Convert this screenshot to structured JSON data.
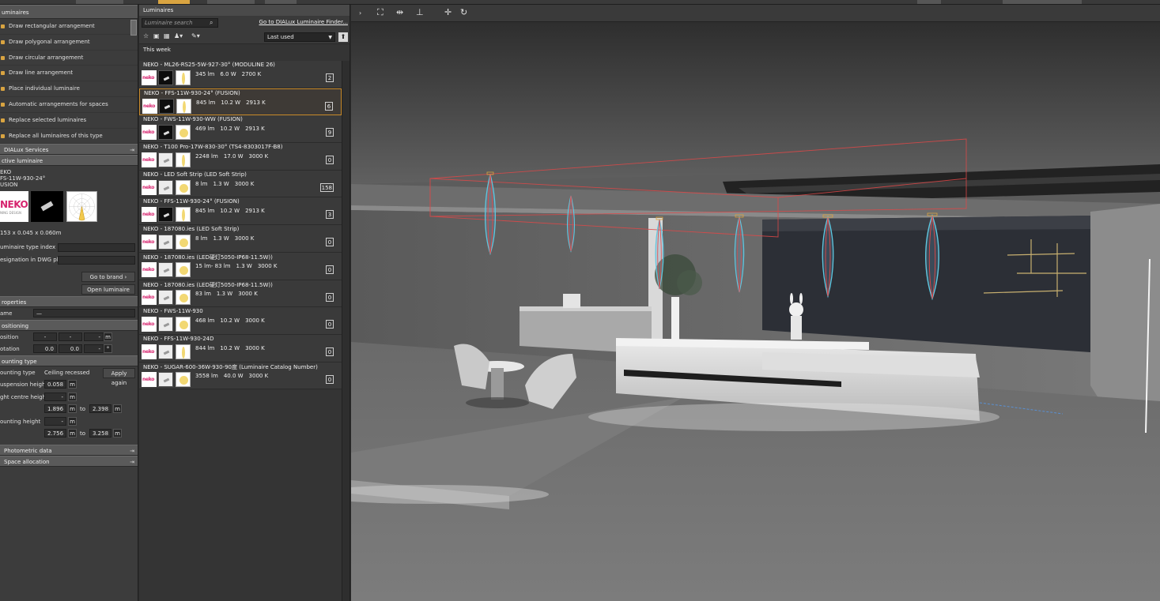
{
  "left_panel": {
    "luminaires_header": "uminaires",
    "actions": [
      "Draw rectangular arrangement",
      "Draw polygonal arrangement",
      "Draw circular arrangement",
      "Draw line arrangement",
      "Place individual luminaire",
      "Automatic arrangements for spaces",
      "Replace selected luminaires",
      "Replace all luminaires of this type"
    ],
    "services_header": "DIALux Services",
    "active_header": "ctive luminaire",
    "active": {
      "brand": "EKO",
      "model": "FS-11W-930-24°",
      "family": "USION",
      "logo_text": "NEKO",
      "logo_sub": "NING DESIGN",
      "dimensions": "153 x 0.045 x 0.060m",
      "type_index_label": "uminaire type index",
      "dwg_label": "esignation in DWG plan",
      "go_to_brand": "Go to brand",
      "open_list": "Open luminaire list"
    },
    "properties_header": "roperties",
    "name_label": "ame",
    "name_value": "—",
    "positioning_header": "ositioning",
    "position_label": "osition",
    "position_values": [
      "-",
      "-",
      "-"
    ],
    "rotation_label": "otation",
    "rotation_values": [
      "0.0",
      "0.0",
      "-"
    ],
    "unit_m": "m",
    "mounting_header": "ounting type",
    "mounting_type_label": "ounting type",
    "mounting_type_value": "Ceiling recessed",
    "apply_again": "Apply again",
    "suspension_label": "uspension height",
    "suspension_value": "0.058",
    "centre_label": "ght centre height",
    "centre_value": "-",
    "centre_from": "1.896",
    "centre_to": "2.398",
    "to_label": "to",
    "mounting_height_label": "ounting height",
    "mounting_height_value": "-",
    "mount_from": "2.756",
    "mount_to": "3.258",
    "photometric_header": "Photometric data",
    "space_header": "Space allocation"
  },
  "middle_panel": {
    "header": "Luminaires",
    "search_placeholder": "Luminaire search",
    "finder_link": "Go to DIALux Luminaire Finder...",
    "sort_value": "Last used",
    "group_label": "This week",
    "luminaires": [
      {
        "name": "NEKO  -  ML26-RS25-5W-927-30° (MODULINE 26)",
        "flux": "345 lm",
        "power": "6.0 W",
        "cct": "2700 K",
        "count": "2",
        "img": "dark",
        "dist": "beam"
      },
      {
        "name": "NEKO  -  FFS-11W-930-24° (FUSION)",
        "flux": "845 lm",
        "power": "10.2 W",
        "cct": "2913 K",
        "count": "6",
        "img": "dark",
        "dist": "beam",
        "selected": true
      },
      {
        "name": "NEKO  -  FWS-11W-930-WW (FUSION)",
        "flux": "469 lm",
        "power": "10.2 W",
        "cct": "2913 K",
        "count": "9",
        "img": "dark",
        "dist": "dot"
      },
      {
        "name": "NEKO  -  T100 Pro-17W-830-30° (TS4-8303017F-B8)",
        "flux": "2248 lm",
        "power": "17.0 W",
        "cct": "3000 K",
        "count": "0",
        "img": "light",
        "dist": "beam"
      },
      {
        "name": "NEKO  -  LED Soft Strip (LED Soft Strip)",
        "flux": "8 lm",
        "power": "1.3 W",
        "cct": "3000 K",
        "count": "158",
        "img": "light",
        "dist": "dot"
      },
      {
        "name": "NEKO  -  FFS-11W-930-24° (FUSION)",
        "flux": "845 lm",
        "power": "10.2 W",
        "cct": "2913 K",
        "count": "3",
        "img": "dark",
        "dist": "beam"
      },
      {
        "name": "NEKO  -  187080.ies (LED Soft Strip)",
        "flux": "8 lm",
        "power": "1.3 W",
        "cct": "3000 K",
        "count": "0",
        "img": "light",
        "dist": "dot"
      },
      {
        "name": "NEKO  -  187080.ies (LED硬灯5050-IP68-11.5W))",
        "flux": "15 lm- 83 lm",
        "power": "1.3 W",
        "cct": "3000 K",
        "count": "0",
        "img": "light",
        "dist": "dot"
      },
      {
        "name": "NEKO  -  187080.ies (LED硬灯5050-IP68-11.5W))",
        "flux": "83 lm",
        "power": "1.3 W",
        "cct": "3000 K",
        "count": "0",
        "img": "light",
        "dist": "dot"
      },
      {
        "name": "NEKO  -  FWS-11W-930",
        "flux": "468 lm",
        "power": "10.2 W",
        "cct": "3000 K",
        "count": "0",
        "img": "light",
        "dist": "dot"
      },
      {
        "name": "NEKO  -  FFS-11W-930-24D",
        "flux": "844 lm",
        "power": "10.2 W",
        "cct": "3000 K",
        "count": "0",
        "img": "light",
        "dist": "beam"
      },
      {
        "name": "NEKO  -  SUGAR-600-36W-930-90度 (Luminaire Catalog Number)",
        "flux": "3558 lm",
        "power": "40.0 W",
        "cct": "3000 K",
        "count": "0",
        "img": "light",
        "dist": "dot"
      }
    ]
  },
  "colors": {
    "accent_orange": "#c88a2a",
    "brand_pink": "#d6246e",
    "cone_cyan": "#5fc7e0",
    "cone_red": "#e04848"
  }
}
